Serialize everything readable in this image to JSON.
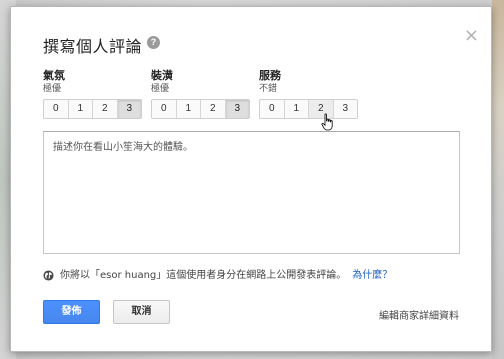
{
  "dialog": {
    "title": "撰寫個人評論",
    "help_icon": "?",
    "close_icon": "×"
  },
  "ratings": [
    {
      "label": "氣氛",
      "sub": "極優",
      "options": [
        "0",
        "1",
        "2",
        "3"
      ],
      "selected": "3"
    },
    {
      "label": "裝潢",
      "sub": "極優",
      "options": [
        "0",
        "1",
        "2",
        "3"
      ],
      "selected": "3"
    },
    {
      "label": "服務",
      "sub": "不錯",
      "options": [
        "0",
        "1",
        "2",
        "3"
      ],
      "selected": "2"
    }
  ],
  "review": {
    "placeholder": "描述你在看山小笙海大的體驗。"
  },
  "notice": {
    "text": "你將以「esor huang」這個使用者身分在網路上公開發表評論。",
    "why_link": "為什麼？"
  },
  "buttons": {
    "publish": "發佈",
    "cancel": "取消"
  },
  "edit_business_link": "編輯商家詳細資料",
  "colors": {
    "primary_button": "#4d90fe",
    "link": "#1a5cc8"
  }
}
